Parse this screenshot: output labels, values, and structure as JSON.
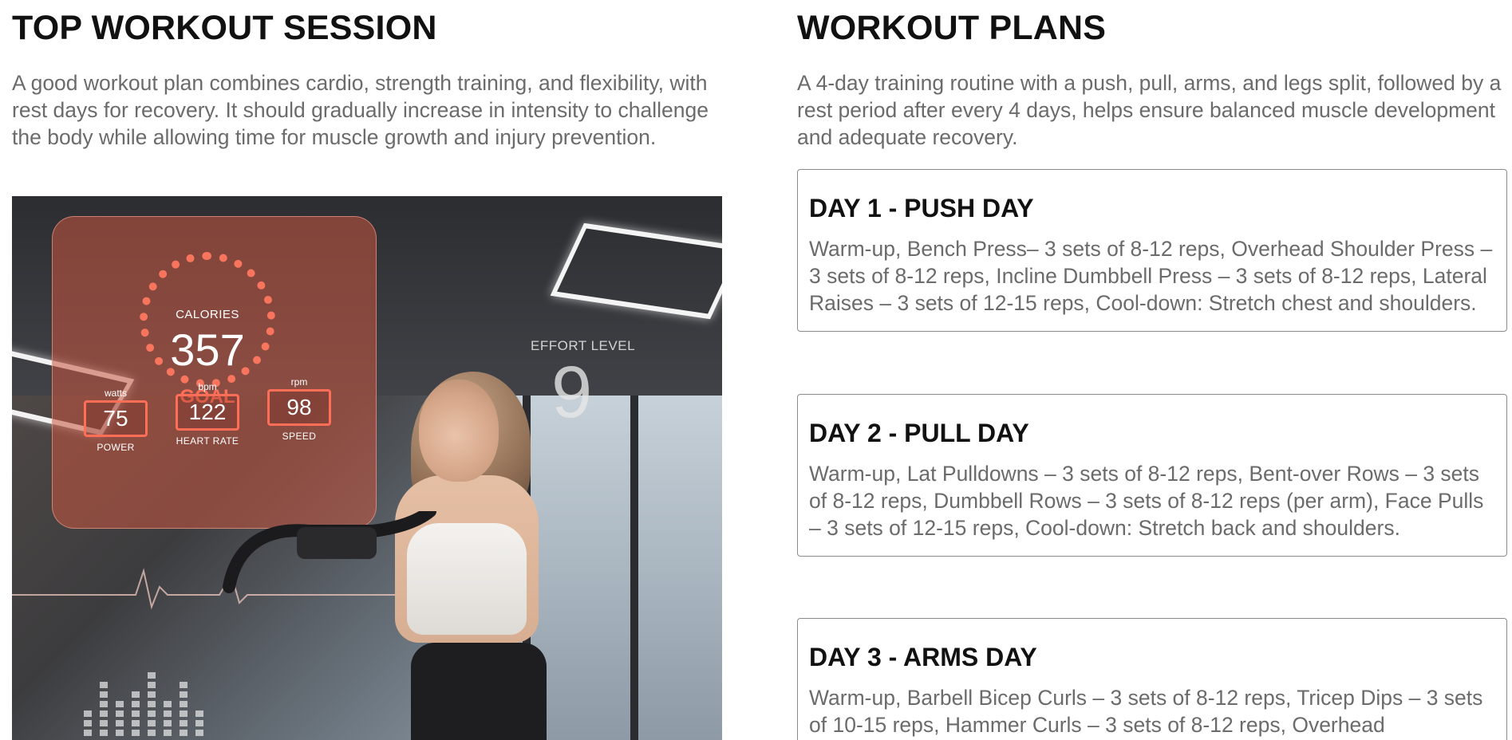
{
  "left": {
    "title": "TOP WORKOUT SESSION",
    "intro": "A good workout plan combines cardio, strength training, and flexibility, with rest days for recovery. It should gradually increase in intensity to challenge the body while allowing time for muscle growth and injury prevention.",
    "hero_image": {
      "hud": {
        "calories_label": "CALORIES",
        "calories_value": "357",
        "goal_label": "GOAL",
        "metrics": [
          {
            "unit": "watts",
            "value": "75",
            "caption": "POWER"
          },
          {
            "unit": "bpm",
            "value": "122",
            "caption": "HEART RATE"
          },
          {
            "unit": "rpm",
            "value": "98",
            "caption": "SPEED"
          }
        ],
        "effort_label": "EFFORT LEVEL",
        "effort_value": "9"
      }
    }
  },
  "right": {
    "title": "WORKOUT PLANS",
    "intro": "A 4-day training routine with a push, pull, arms, and legs split, followed by a rest period after every 4 days, helps ensure balanced muscle development and adequate recovery.",
    "plans": [
      {
        "title": "DAY 1 - PUSH DAY",
        "description": "Warm-up, Bench Press– 3 sets of 8-12 reps, Overhead Shoulder Press – 3 sets of 8-12 reps, Incline Dumbbell Press – 3 sets of 8-12 reps, Lateral Raises – 3 sets of 12-15 reps, Cool-down: Stretch chest and shoulders."
      },
      {
        "title": "DAY 2 - PULL DAY",
        "description": "Warm-up, Lat Pulldowns – 3 sets of 8-12 reps, Bent-over Rows – 3 sets of 8-12 reps, Dumbbell Rows – 3 sets of 8-12 reps (per arm), Face Pulls – 3 sets of 12-15 reps, Cool-down: Stretch back and shoulders."
      },
      {
        "title": "DAY 3 - ARMS DAY",
        "description": "Warm-up, Barbell Bicep Curls – 3 sets of 8-12 reps, Tricep Dips – 3 sets of 10-15 reps, Hammer Curls – 3 sets of 8-12 reps, Overhead"
      }
    ]
  }
}
